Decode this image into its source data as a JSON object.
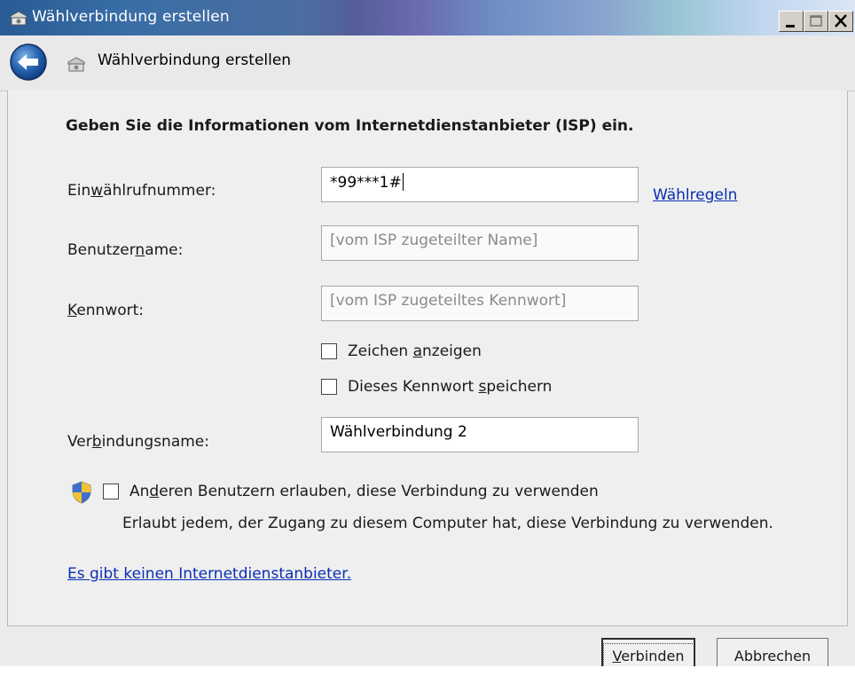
{
  "window": {
    "title": "Wählverbindung erstellen",
    "controls": [
      "minimize",
      "maximize",
      "close"
    ]
  },
  "toolbar": {
    "title": "Wählverbindung erstellen",
    "icons": [
      "back-arrow-icon",
      "phone-connection-icon"
    ]
  },
  "form": {
    "heading": "Geben Sie die Informationen vom Internetdienstanbieter (ISP) ein.",
    "phone": {
      "label_pre": "Ein",
      "label_acc": "w",
      "label_post": "ählrufnummer:",
      "value": "*99***1#"
    },
    "dial_rules_link": "Wählregeln",
    "username": {
      "label_pre": "Benutzer",
      "label_acc": "n",
      "label_post": "ame:",
      "placeholder": "[vom ISP zugeteilter Name]"
    },
    "password": {
      "label_pre": "",
      "label_acc": "K",
      "label_post": "ennwort:",
      "placeholder": "[vom ISP zugeteiltes Kennwort]"
    },
    "show_chars": {
      "pre": "Zeichen ",
      "acc": "a",
      "post": "nzeigen",
      "checked": false
    },
    "save_password": {
      "pre": "Dieses Kennwort ",
      "acc": "s",
      "post": "peichern",
      "checked": false
    },
    "connection_name": {
      "label_pre": "Ver",
      "label_acc": "b",
      "label_post": "indungsname:",
      "value": "Wählverbindung 2"
    },
    "allow_others": {
      "pre": "An",
      "acc": "d",
      "post": "eren Benutzern erlauben, diese Verbindung zu verwenden",
      "checked": false,
      "description": "Erlaubt jedem, der Zugang zu diesem Computer hat, diese Verbindung zu verwenden."
    },
    "no_isp_link": "Es gibt keinen Internetdienstanbieter."
  },
  "buttons": {
    "connect_acc": "V",
    "connect_rest": "erbinden",
    "cancel": "Abbrechen"
  }
}
